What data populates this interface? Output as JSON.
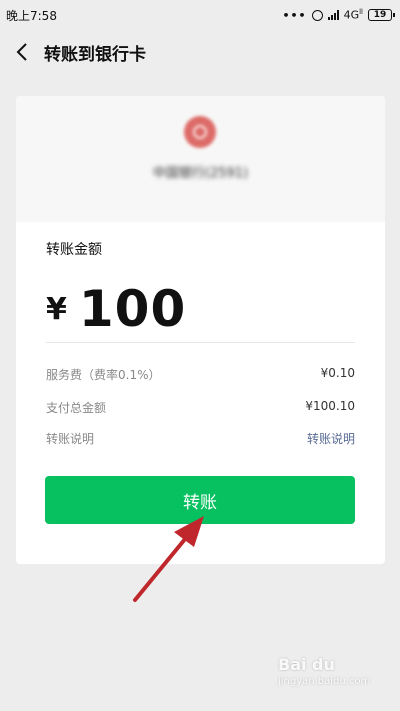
{
  "status_bar": {
    "time": "晚上7:58",
    "dots": "•••",
    "network": "4G",
    "network_suffix": "ll",
    "battery": "19"
  },
  "nav": {
    "title": "转账到银行卡",
    "back_icon": "chevron-left-icon"
  },
  "bank": {
    "logo_icon": "bank-of-china-logo",
    "name": "中国银行(2591)"
  },
  "amount": {
    "label": "转账金额",
    "currency": "¥",
    "value": "100"
  },
  "details": [
    {
      "label": "服务费（费率0.1%）",
      "value": "¥0.10"
    },
    {
      "label": "支付总金额",
      "value": "¥100.10"
    },
    {
      "label": "转账说明",
      "value": "转账说明"
    }
  ],
  "button": {
    "label": "转账"
  },
  "colors": {
    "primary": "#07c160",
    "link": "#576b95",
    "background": "#ededed",
    "annotation_arrow": "#c0272d"
  },
  "watermark": {
    "logo": "Bai du",
    "text": "jingyan.baidu.com"
  }
}
